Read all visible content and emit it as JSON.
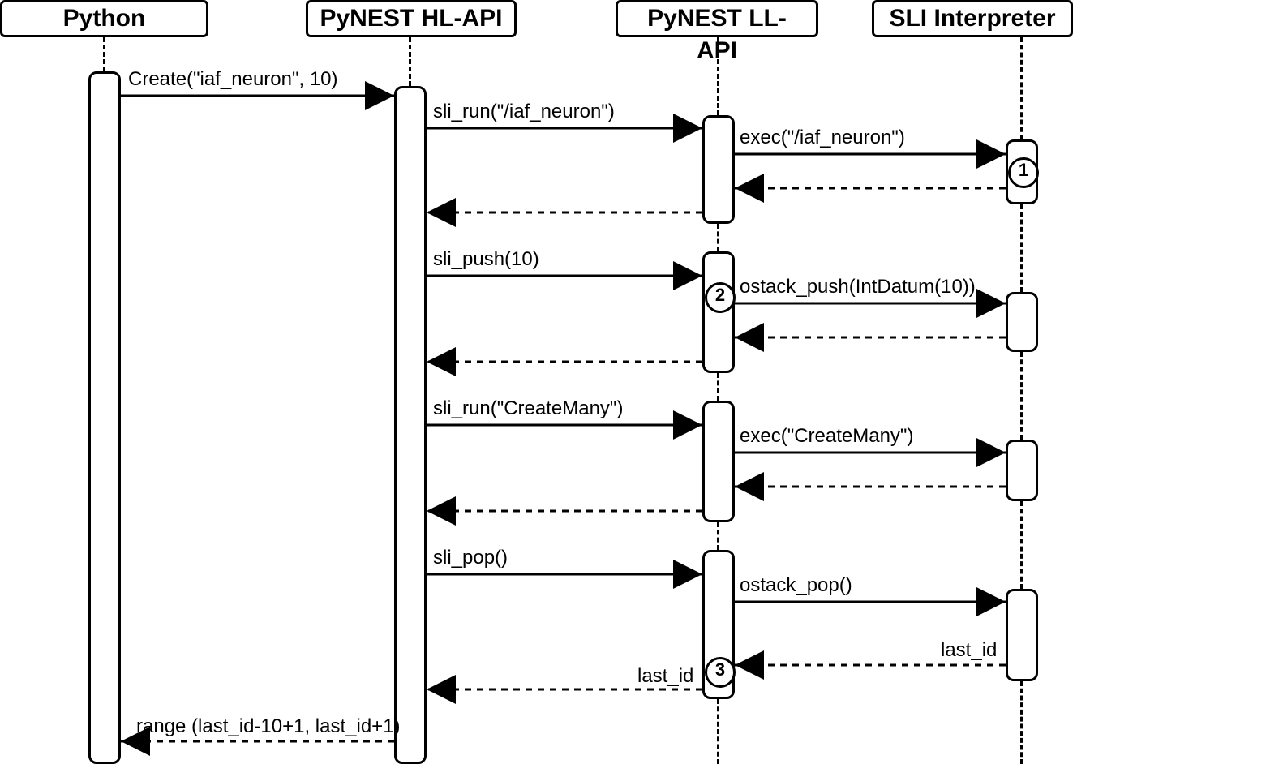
{
  "participants": {
    "python": "Python",
    "hlapi": "PyNEST HL-API",
    "llapi": "PyNEST LL-API",
    "sli": "SLI Interpreter"
  },
  "messages": {
    "create": "Create(\"iaf_neuron\", 10)",
    "sli_run_iaf": "sli_run(\"/iaf_neuron\")",
    "exec_iaf": "exec(\"/iaf_neuron\")",
    "sli_push10": "sli_push(10)",
    "ostack_push": "ostack_push(IntDatum(10))",
    "sli_run_cm": "sli_run(\"CreateMany\")",
    "exec_cm": "exec(\"CreateMany\")",
    "sli_pop": "sli_pop()",
    "ostack_pop": "ostack_pop()",
    "last_id1": "last_id",
    "last_id2": "last_id",
    "range": "range (last_id-10+1, last_id+1)"
  },
  "nums": {
    "n1": "1",
    "n2": "2",
    "n3": "3"
  }
}
